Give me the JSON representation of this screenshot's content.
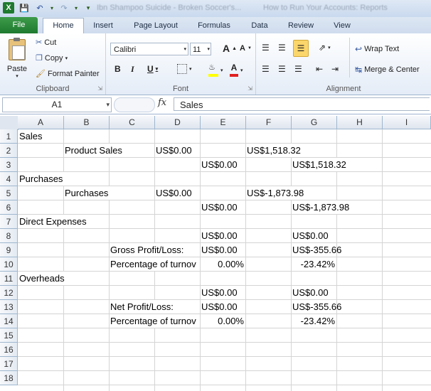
{
  "titlebar": {
    "title": "Ibn Shampoo Suicide - Broken Soccer's...",
    "subtitle": "How to Run Your Accounts: Reports"
  },
  "tabs": [
    "File",
    "Home",
    "Insert",
    "Page Layout",
    "Formulas",
    "Data",
    "Review",
    "View"
  ],
  "ribbon": {
    "clipboard": {
      "label": "Clipboard",
      "paste": "Paste",
      "cut": "Cut",
      "copy": "Copy",
      "format_painter": "Format Painter"
    },
    "font": {
      "label": "Font",
      "name": "Calibri",
      "size": "11",
      "bold": "B",
      "italic": "I",
      "underline": "U",
      "grow": "A",
      "shrink": "A"
    },
    "alignment": {
      "label": "Alignment",
      "wrap": "Wrap Text",
      "merge": "Merge & Center"
    }
  },
  "formula_bar": {
    "name_box": "A1",
    "fx": "fx",
    "content": "Sales"
  },
  "columns": [
    "A",
    "B",
    "C",
    "D",
    "E",
    "F",
    "G",
    "H",
    "I"
  ],
  "rows": [
    "1",
    "2",
    "3",
    "4",
    "5",
    "6",
    "7",
    "8",
    "9",
    "10",
    "11",
    "12",
    "13",
    "14",
    "15",
    "16",
    "17",
    "18"
  ],
  "cells": {
    "r1": {
      "A": "Sales"
    },
    "r2": {
      "B": "Product Sales",
      "D": "US$0.00",
      "F": "US$1,518.32"
    },
    "r3": {
      "E": "US$0.00",
      "G": "US$1,518.32"
    },
    "r4": {
      "A": "Purchases"
    },
    "r5": {
      "B": "Purchases",
      "D": "US$0.00",
      "F": "US$-1,873.98"
    },
    "r6": {
      "E": "US$0.00",
      "G": "US$-1,873.98"
    },
    "r7": {
      "A": "Direct Expenses"
    },
    "r8": {
      "E": "US$0.00",
      "G": "US$0.00"
    },
    "r9": {
      "C": "Gross Profit/Loss:",
      "E": "US$0.00",
      "G": "US$-355.66"
    },
    "r10": {
      "C": "Percentage of turnov",
      "E": "0.00%",
      "G": "-23.42%"
    },
    "r11": {
      "A": "Overheads"
    },
    "r12": {
      "E": "US$0.00",
      "G": "US$0.00"
    },
    "r13": {
      "C": "Net Profit/Loss:",
      "E": "US$0.00",
      "G": "US$-355.66"
    },
    "r14": {
      "C": "Percentage of turnov",
      "E": "0.00%",
      "G": "-23.42%"
    }
  }
}
